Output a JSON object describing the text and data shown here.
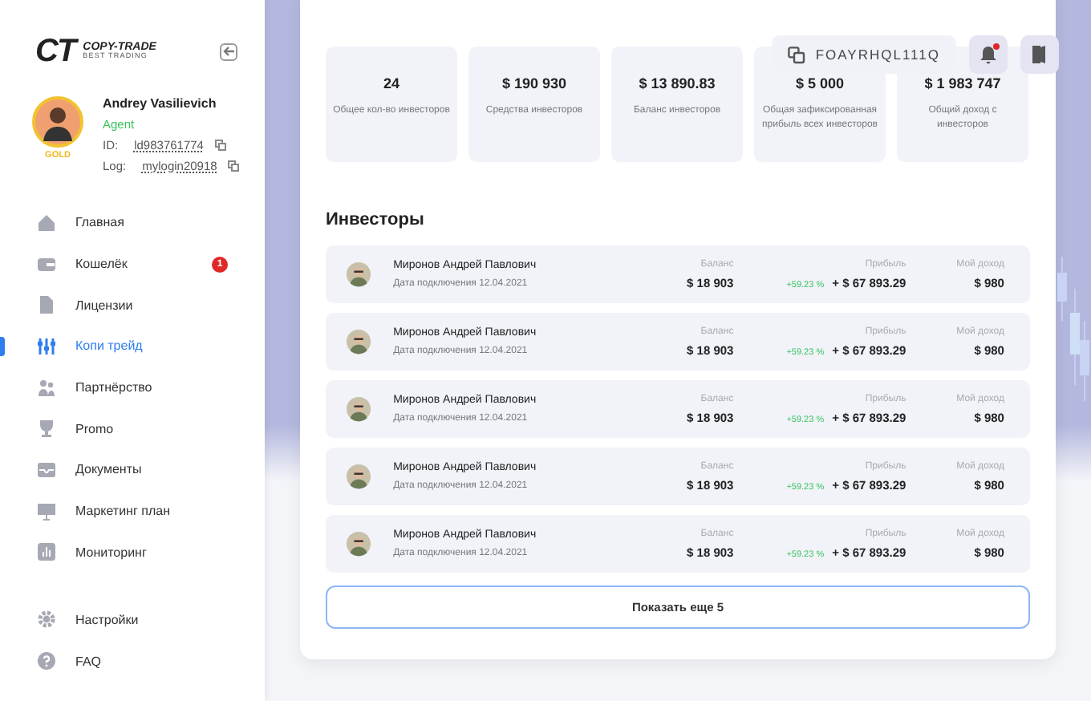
{
  "logo": {
    "mark": "CT",
    "title": "COPY-TRADE",
    "subtitle": "BEST TRADING"
  },
  "profile": {
    "name": "Andrey Vasilievich",
    "role": "Agent",
    "rank": "GOLD",
    "id_label": "ID:",
    "id": "ld983761774",
    "login_label": "Log:",
    "login": "mylogin20918"
  },
  "nav": [
    {
      "label": "Главная",
      "selected": false
    },
    {
      "label": "Кошелёк",
      "selected": false,
      "badge": "1"
    },
    {
      "label": "Лицензии",
      "selected": false
    },
    {
      "label": "Копи трейд",
      "selected": true
    },
    {
      "label": "Партнёрство",
      "selected": false
    },
    {
      "label": "Promo",
      "selected": false
    },
    {
      "label": "Документы",
      "selected": false
    },
    {
      "label": "Маркетинг план",
      "selected": false
    },
    {
      "label": "Мониторинг",
      "selected": false
    }
  ],
  "nav_bottom": [
    {
      "label": "Настройки",
      "selected": false
    },
    {
      "label": "FAQ",
      "selected": false
    }
  ],
  "header": {
    "referral_code": "FOAYRHQL111Q",
    "notification": true
  },
  "stats": [
    {
      "value": "24",
      "label": "Общее кол-во инвесторов"
    },
    {
      "value": "$ 190 930",
      "label": "Средства инвесторов"
    },
    {
      "value": "$ 13 890.83",
      "label": "Баланс инвесторов"
    },
    {
      "value": "$ 5 000",
      "label": "Общая зафиксированная прибыль всех инвесторов"
    },
    {
      "value": "$ 1 983 747",
      "label": "Общий доход с инвесторов"
    }
  ],
  "investors_title": "Инвесторы",
  "investors": [
    {
      "name": "Миронов Андрей Павлович",
      "date": "Дата подключения 12.04.2021",
      "balance_label": "Баланс",
      "balance": "$ 18 903",
      "profit_label": "Прибыль",
      "profit_percent": "+59.23 %",
      "profit": "+ $ 67 893.29",
      "income_label": "Мой доход",
      "income": "$ 980"
    },
    {
      "name": "Миронов Андрей Павлович",
      "date": "Дата подключения 12.04.2021",
      "balance_label": "Баланс",
      "balance": "$ 18 903",
      "profit_label": "Прибыль",
      "profit_percent": "+59.23 %",
      "profit": "+ $ 67 893.29",
      "income_label": "Мой доход",
      "income": "$ 980"
    },
    {
      "name": "Миронов Андрей Павлович",
      "date": "Дата подключения 12.04.2021",
      "balance_label": "Баланс",
      "balance": "$ 18 903",
      "profit_label": "Прибыль",
      "profit_percent": "+59.23 %",
      "profit": "+ $ 67 893.29",
      "income_label": "Мой доход",
      "income": "$ 980"
    },
    {
      "name": "Миронов Андрей Павлович",
      "date": "Дата подключения 12.04.2021",
      "balance_label": "Баланс",
      "balance": "$ 18 903",
      "profit_label": "Прибыль",
      "profit_percent": "+59.23 %",
      "profit": "+ $ 67 893.29",
      "income_label": "Мой доход",
      "income": "$ 980"
    },
    {
      "name": "Миронов Андрей Павлович",
      "date": "Дата подключения 12.04.2021",
      "balance_label": "Баланс",
      "balance": "$ 18 903",
      "profit_label": "Прибыль",
      "profit_percent": "+59.23 %",
      "profit": "+ $ 67 893.29",
      "income_label": "Мой доход",
      "income": "$ 980"
    }
  ],
  "show_more": "Показать еще 5"
}
